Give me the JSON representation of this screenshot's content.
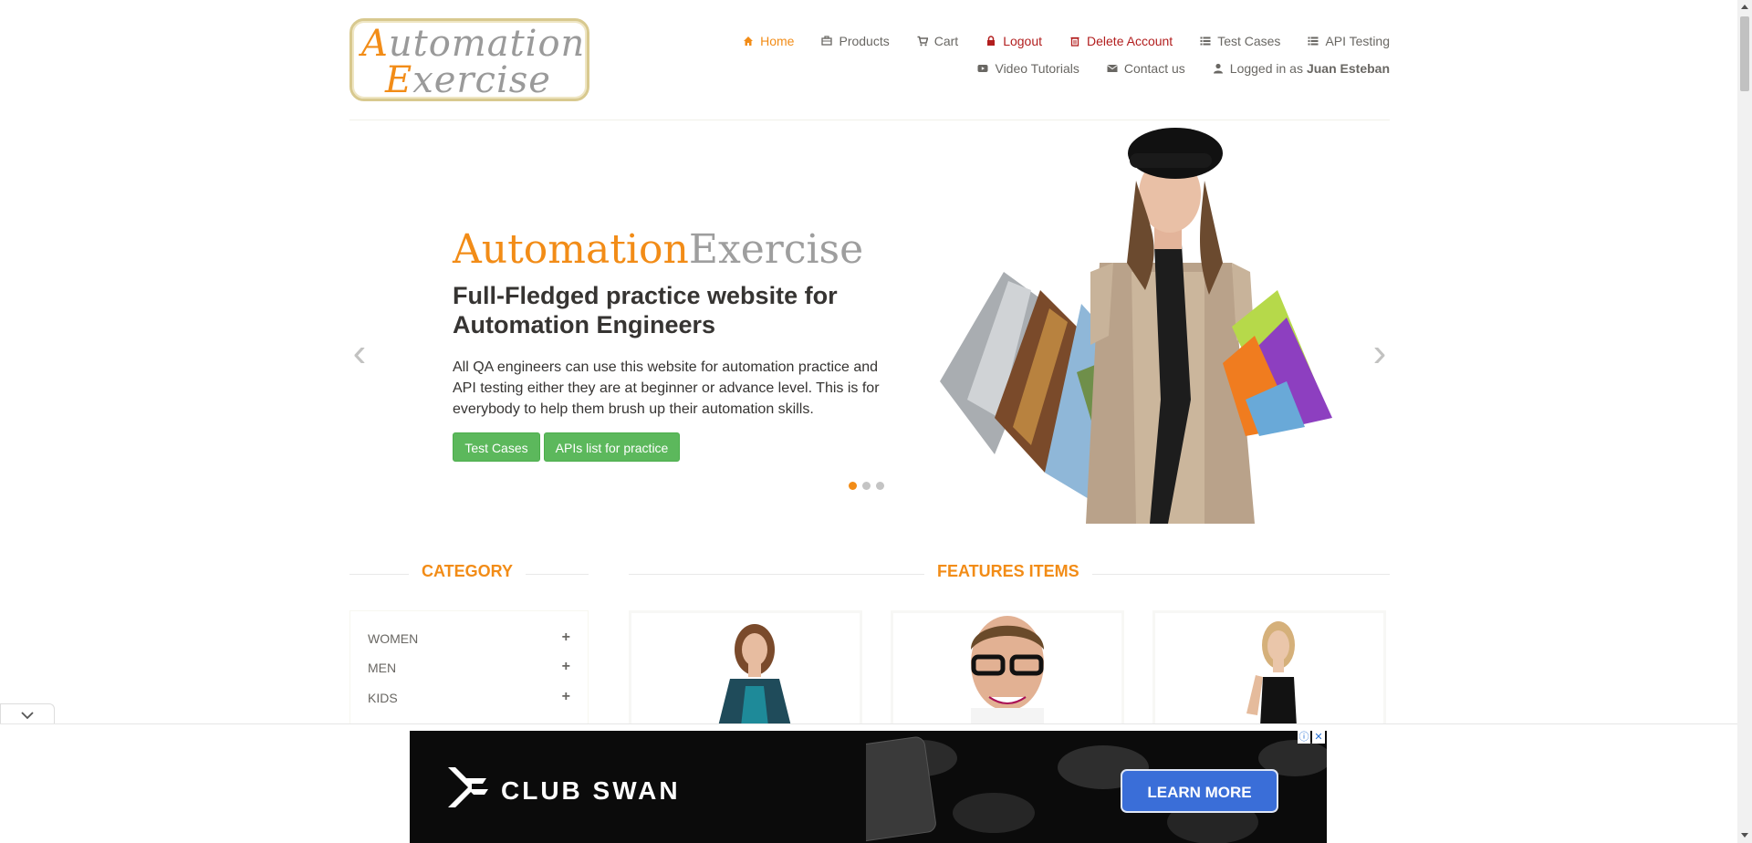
{
  "logo": {
    "word1_cap": "A",
    "word1_rest": "utomation",
    "word2_cap": "E",
    "word2_rest": "xercise"
  },
  "nav": {
    "row1": [
      {
        "label": "Home",
        "icon": "home-icon",
        "state": "active"
      },
      {
        "label": "Products",
        "icon": "briefcase-icon"
      },
      {
        "label": "Cart",
        "icon": "cart-icon"
      },
      {
        "label": "Logout",
        "icon": "lock-icon",
        "state": "red"
      },
      {
        "label": "Delete Account",
        "icon": "trash-icon",
        "state": "red"
      },
      {
        "label": "Test Cases",
        "icon": "list-icon"
      },
      {
        "label": "API Testing",
        "icon": "list-icon"
      }
    ],
    "row2": [
      {
        "label": "Video Tutorials",
        "icon": "youtube-icon"
      },
      {
        "label": "Contact us",
        "icon": "envelope-icon"
      },
      {
        "label": "Logged in as",
        "icon": "user-icon",
        "username": "Juan Esteban"
      }
    ]
  },
  "slider": {
    "title_a": "Automation",
    "title_b": "Exercise",
    "heading": "Full-Fledged practice website for Automation Engineers",
    "paragraph": "All QA engineers can use this website for automation practice and API testing either they are at beginner or advance level. This is for everybody to help them brush up their automation skills.",
    "button1": "Test Cases",
    "button2": "APIs list for practice",
    "active_dot": 1,
    "dot_count": 3
  },
  "category": {
    "title": "CATEGORY",
    "items": [
      "WOMEN",
      "MEN",
      "KIDS"
    ]
  },
  "features": {
    "title": "FEATURES ITEMS"
  },
  "ad": {
    "brand": "CLUB SWAN",
    "cta": "LEARN MORE"
  },
  "colors": {
    "accent": "#f28c17",
    "button": "#5cb85c",
    "danger": "#b21e1e",
    "ad_button": "#3a6ed8"
  }
}
